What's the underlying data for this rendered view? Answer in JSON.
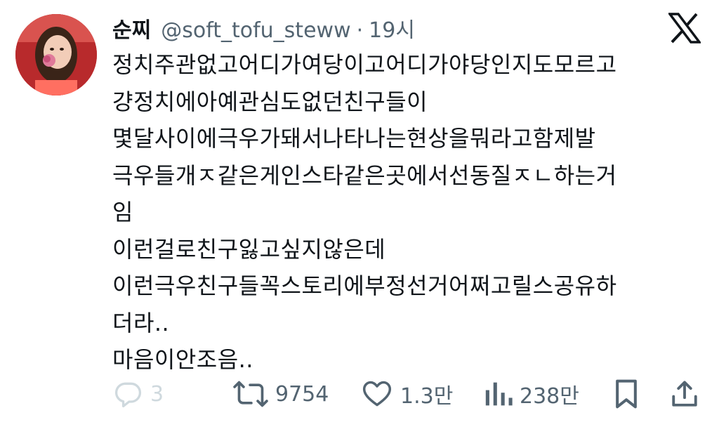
{
  "tweet": {
    "author": {
      "display_name": "순찌",
      "handle": "@soft_tofu_steww",
      "separator": "·",
      "time": "19시"
    },
    "lines": [
      "정치주관없고어디가여당이고어디가야당인지도모르고",
      "걍정치에아예관심도없던친구들이",
      "몇달사이에극우가돼서나타나는현상을뭐라고함제발",
      "극우들개ㅈ같은게인스타같은곳에서선동질ㅈㄴ하는거",
      "임",
      "이런걸로친구잃고싶지않은데",
      "이런극우친구들꼭스토리에부정선거어쩌고릴스공유하",
      "더라..",
      "마음이안조음.."
    ]
  },
  "actions": {
    "reply": {
      "icon": "reply-icon",
      "count": "3"
    },
    "retweet": {
      "icon": "retweet-icon",
      "count": "9754"
    },
    "like": {
      "icon": "heart-icon",
      "count": "1.3만"
    },
    "views": {
      "icon": "views-icon",
      "count": "238만"
    },
    "bookmark": {
      "icon": "bookmark-icon"
    },
    "share": {
      "icon": "share-icon"
    }
  },
  "colors": {
    "text": "#0f1419",
    "secondary": "#536471",
    "disabled": "#cfd9de"
  }
}
